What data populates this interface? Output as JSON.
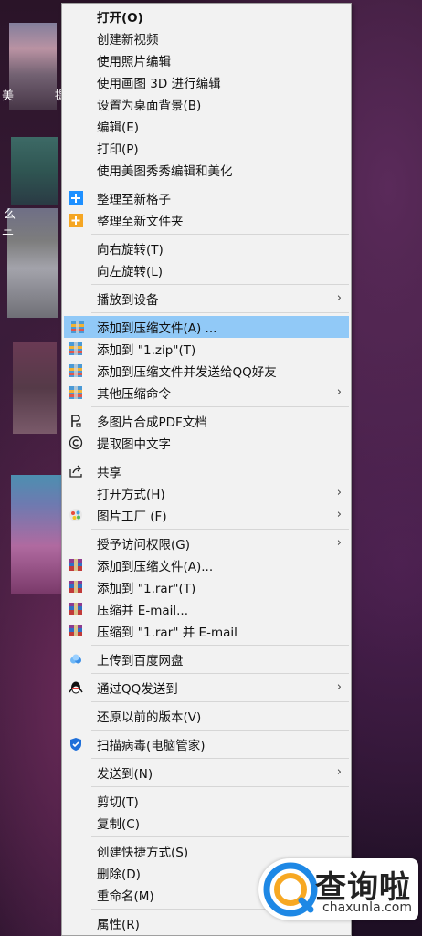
{
  "desktop": {
    "labels": [
      "美",
      "提",
      "么",
      "三"
    ]
  },
  "context_menu": {
    "groups": [
      [
        {
          "label": "打开(O)",
          "bold": true
        },
        {
          "label": "创建新视频"
        },
        {
          "label": "使用照片编辑"
        },
        {
          "label": "使用画图 3D 进行编辑"
        },
        {
          "label": "设置为桌面背景(B)"
        },
        {
          "label": "编辑(E)"
        },
        {
          "label": "打印(P)"
        },
        {
          "label": "使用美图秀秀编辑和美化"
        }
      ],
      [
        {
          "label": "整理至新格子",
          "icon": "plus-blue-icon"
        },
        {
          "label": "整理至新文件夹",
          "icon": "folder-plus-icon"
        }
      ],
      [
        {
          "label": "向右旋转(T)"
        },
        {
          "label": "向左旋转(L)"
        }
      ],
      [
        {
          "label": "播放到设备",
          "submenu": true
        }
      ],
      [
        {
          "label": "添加到压缩文件(A) ...",
          "icon": "archive-icon",
          "highlighted": true
        },
        {
          "label": "添加到 \"1.zip\"(T)",
          "icon": "archive-icon"
        },
        {
          "label": "添加到压缩文件并发送给QQ好友",
          "icon": "archive-icon"
        },
        {
          "label": "其他压缩命令",
          "icon": "archive-icon",
          "submenu": true
        }
      ],
      [
        {
          "label": "多图片合成PDF文档",
          "icon": "pdf-icon"
        },
        {
          "label": "提取图中文字",
          "icon": "ocr-icon"
        }
      ],
      [
        {
          "label": "共享",
          "icon": "share-icon"
        },
        {
          "label": "打开方式(H)",
          "submenu": true
        },
        {
          "label": "图片工厂 (F)",
          "icon": "picture-factory-icon",
          "submenu": true
        }
      ],
      [
        {
          "label": "授予访问权限(G)",
          "submenu": true
        },
        {
          "label": "添加到压缩文件(A)...",
          "icon": "winrar-icon"
        },
        {
          "label": "添加到 \"1.rar\"(T)",
          "icon": "winrar-icon"
        },
        {
          "label": "压缩并 E-mail...",
          "icon": "winrar-icon"
        },
        {
          "label": "压缩到 \"1.rar\" 并 E-mail",
          "icon": "winrar-icon"
        }
      ],
      [
        {
          "label": "上传到百度网盘",
          "icon": "baidu-netdisk-icon"
        }
      ],
      [
        {
          "label": "通过QQ发送到",
          "icon": "qq-icon",
          "submenu": true
        }
      ],
      [
        {
          "label": "还原以前的版本(V)"
        }
      ],
      [
        {
          "label": "扫描病毒(电脑管家)",
          "icon": "shield-icon"
        }
      ],
      [
        {
          "label": "发送到(N)",
          "submenu": true
        }
      ],
      [
        {
          "label": "剪切(T)"
        },
        {
          "label": "复制(C)"
        }
      ],
      [
        {
          "label": "创建快捷方式(S)"
        },
        {
          "label": "删除(D)"
        },
        {
          "label": "重命名(M)"
        }
      ],
      [
        {
          "label": "属性(R)"
        }
      ]
    ]
  },
  "submenu_arrow": "›",
  "watermark": {
    "title": "查询啦",
    "url": "chaxunla.com"
  }
}
